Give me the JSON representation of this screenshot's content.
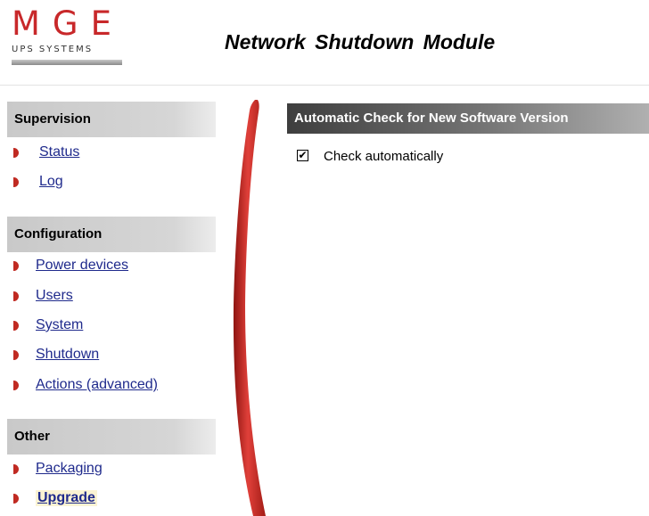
{
  "logo": {
    "brand": "MGE",
    "subtitle": "UPS SYSTEMS"
  },
  "app_title": "Network  Shutdown  Module",
  "sidebar": {
    "sections": [
      {
        "title": "Supervision",
        "items": [
          "Status",
          "Log"
        ]
      },
      {
        "title": "Configuration",
        "items": [
          "Power devices",
          "Users",
          "System",
          "Shutdown",
          "Actions (advanced)"
        ]
      },
      {
        "title": "Other",
        "items": [
          "Packaging",
          "Upgrade"
        ]
      }
    ],
    "current_item": "Upgrade"
  },
  "content": {
    "header": "Automatic Check for New Software Version",
    "checkbox_label": "Check automatically",
    "checkbox_checked": true
  },
  "colors": {
    "brand_red": "#c8282a",
    "link": "#1f2a8c",
    "header_dark": "#3e3e3e"
  }
}
